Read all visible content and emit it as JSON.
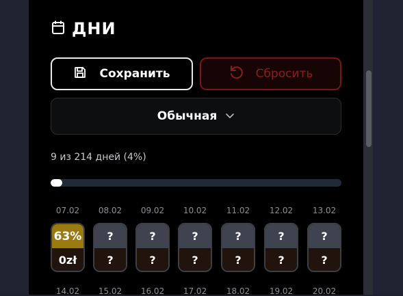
{
  "header": {
    "title": "ДНИ",
    "icon": "calendar-icon"
  },
  "buttons": {
    "save": "Сохранить",
    "reset": "Сбросить"
  },
  "select": {
    "value": "Обычная"
  },
  "progress": {
    "text": "9 из 214 дней (4%)",
    "fraction": 0.04
  },
  "days_row1": [
    {
      "date": "07.02",
      "top": "63%",
      "bottom": "0zł",
      "active": true
    },
    {
      "date": "08.02",
      "top": "?",
      "bottom": "?"
    },
    {
      "date": "09.02",
      "top": "?",
      "bottom": "?"
    },
    {
      "date": "10.02",
      "top": "?",
      "bottom": "?"
    },
    {
      "date": "11.02",
      "top": "?",
      "bottom": "?"
    },
    {
      "date": "12.02",
      "top": "?",
      "bottom": "?"
    },
    {
      "date": "13.02",
      "top": "?",
      "bottom": "?"
    }
  ],
  "days_row2_dates": [
    "14.02",
    "15.02",
    "16.02",
    "17.02",
    "18.02",
    "19.02",
    "20.02"
  ],
  "colors": {
    "accent_active": "#9b7b10",
    "danger": "#8b1d1f",
    "card_top": "#3f4350",
    "card_bottom": "#21140c"
  }
}
